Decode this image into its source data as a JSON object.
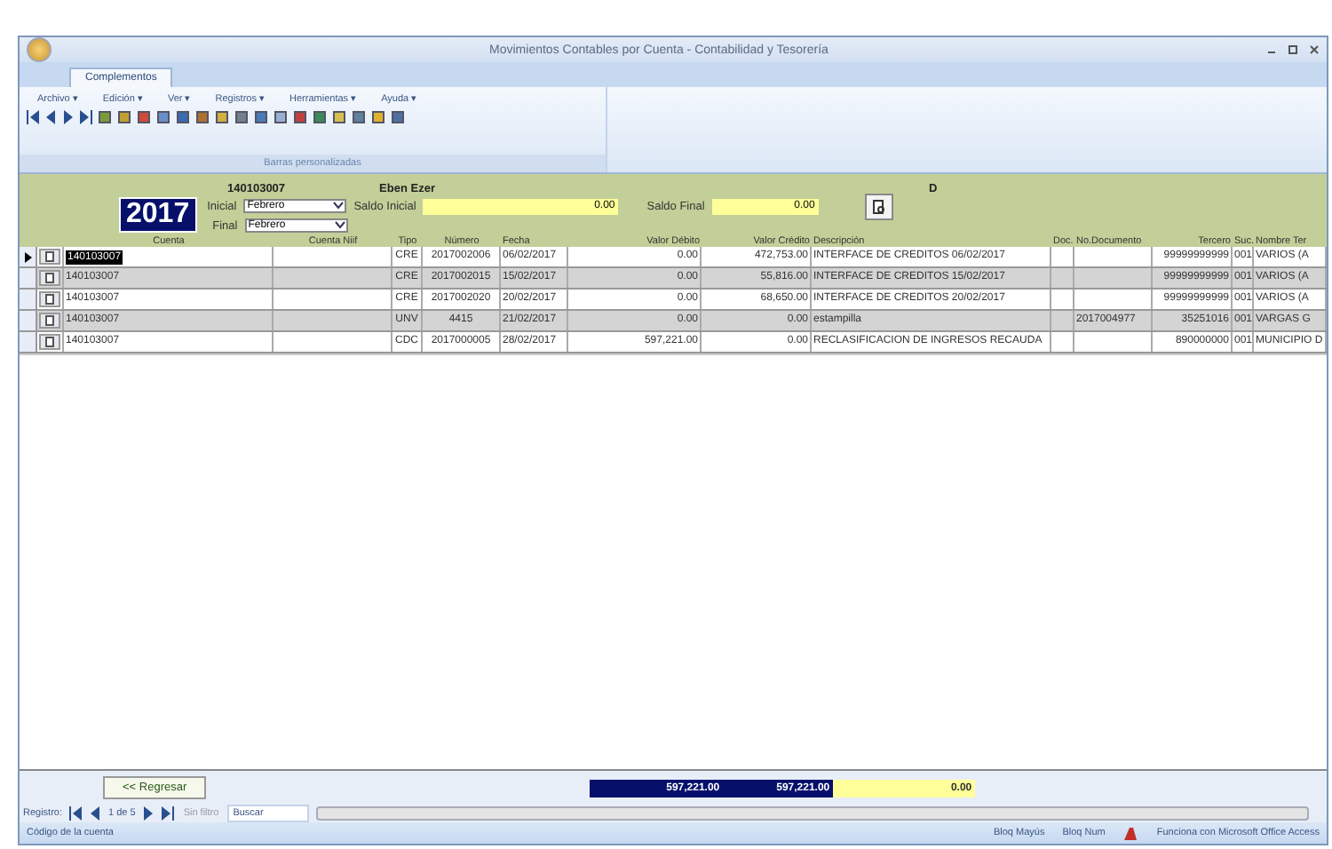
{
  "window": {
    "title": "Movimientos Contables por Cuenta - Contabilidad y Tesorería"
  },
  "ribbon": {
    "tabs": [
      {
        "label": "Complementos",
        "selected": true
      }
    ],
    "menus": [
      "Archivo ▾",
      "Edición ▾",
      "Ver ▾",
      "Registros ▾",
      "Herramientas ▾",
      "Ayuda ▾"
    ],
    "group_label": "Barras personalizadas"
  },
  "header": {
    "account": "140103007",
    "name": "Eben Ezer",
    "nature": "D",
    "year": "2017",
    "start": {
      "label": "Inicial",
      "value": "Febrero"
    },
    "end": {
      "label": "Final",
      "value": "Febrero"
    },
    "opening_balance": {
      "label": "Saldo Inicial",
      "value": "0.00"
    },
    "closing_balance": {
      "label": "Saldo Final",
      "value": "0.00"
    }
  },
  "table": {
    "columns": [
      "Cuenta",
      "Cuenta Niif",
      "Tipo",
      "Número",
      "Fecha",
      "Valor Débito",
      "Valor Crédito",
      "Descripción",
      "Doc.",
      "No.Documento",
      "Tercero",
      "Suc.",
      "Nombre Ter"
    ],
    "rows": [
      {
        "selected": true,
        "cells": [
          "140103007",
          "",
          "CRE",
          "2017002006",
          "06/02/2017",
          "0.00",
          "472,753.00",
          "INTERFACE DE CREDITOS 06/02/2017",
          "",
          "",
          "99999999999",
          "001",
          "VARIOS (A"
        ]
      },
      {
        "selected": false,
        "cells": [
          "140103007",
          "",
          "CRE",
          "2017002015",
          "15/02/2017",
          "0.00",
          "55,816.00",
          "INTERFACE DE CREDITOS 15/02/2017",
          "",
          "",
          "99999999999",
          "001",
          "VARIOS (A"
        ]
      },
      {
        "selected": false,
        "cells": [
          "140103007",
          "",
          "CRE",
          "2017002020",
          "20/02/2017",
          "0.00",
          "68,650.00",
          "INTERFACE DE CREDITOS 20/02/2017",
          "",
          "",
          "99999999999",
          "001",
          "VARIOS (A"
        ]
      },
      {
        "selected": false,
        "cells": [
          "140103007",
          "",
          "UNV",
          "4415",
          "21/02/2017",
          "0.00",
          "0.00",
          "estampilla",
          "",
          "2017004977",
          "35251016",
          "001",
          "VARGAS G"
        ]
      },
      {
        "selected": false,
        "cells": [
          "140103007",
          "",
          "CDC",
          "2017000005",
          "28/02/2017",
          "597,221.00",
          "0.00",
          "RECLASIFICACION DE INGRESOS RECAUDA",
          "",
          "",
          "890000000",
          "001",
          "MUNICIPIO D"
        ]
      }
    ]
  },
  "footer": {
    "back_button": "<< Regresar",
    "total_debit": "597,221.00",
    "total_credit": "597,221.00",
    "difference": "0.00"
  },
  "navigation": {
    "label": "Registro:",
    "position": "1 de 5",
    "filter": "Sin filtro",
    "search": "Buscar"
  },
  "status_bar": {
    "message": "Código de la cuenta",
    "caps": "Bloq Mayús",
    "num": "Bloq Num",
    "powered": "Funciona con Microsoft Office Access"
  }
}
